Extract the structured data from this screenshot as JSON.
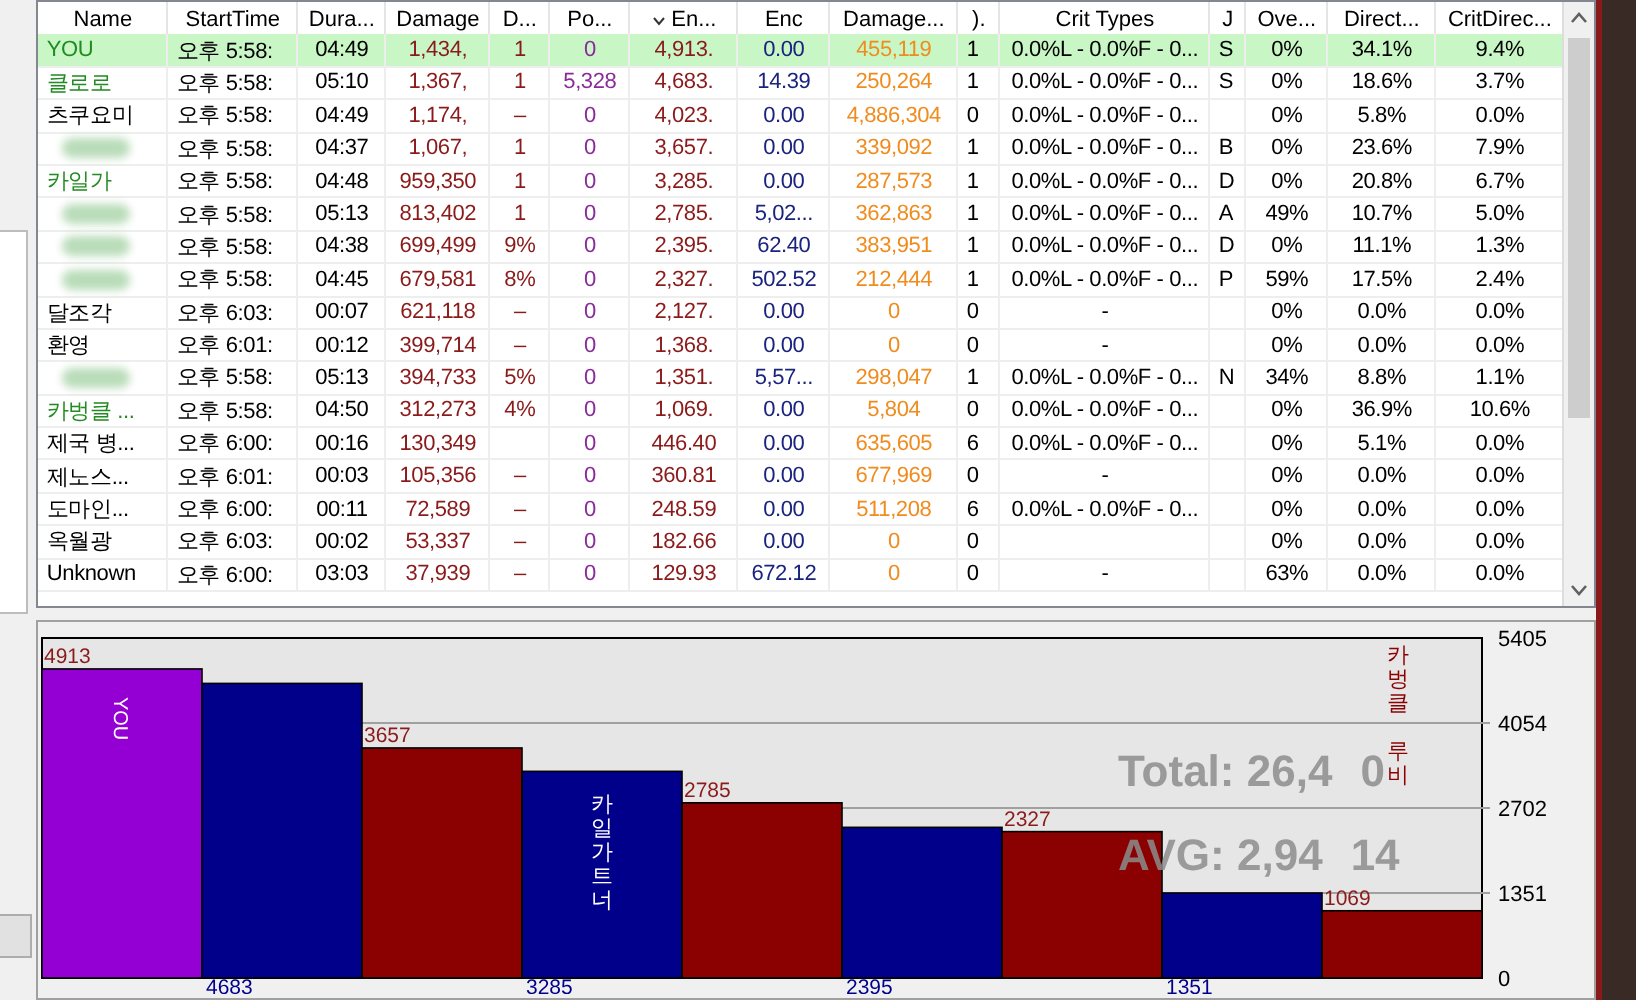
{
  "table": {
    "columns": [
      {
        "label": "Name"
      },
      {
        "label": "StartTime"
      },
      {
        "label": "Dura..."
      },
      {
        "label": "Damage"
      },
      {
        "label": "D..."
      },
      {
        "label": "Po..."
      },
      {
        "label": "En...",
        "sorted": true
      },
      {
        "label": "Enc"
      },
      {
        "label": "Damage..."
      },
      {
        "label": ")."
      },
      {
        "label": "Crit Types"
      },
      {
        "label": "J"
      },
      {
        "label": "Ove..."
      },
      {
        "label": "Direct..."
      },
      {
        "label": "CritDirec..."
      }
    ],
    "rows": [
      {
        "selected": true,
        "color": "#228b22",
        "cells": [
          "YOU",
          "오후 5:58:",
          "04:49",
          "1,434,",
          "1",
          "0",
          "4,913.",
          "0.00",
          "455,119",
          "1",
          "0.0%L - 0.0%F - 0...",
          "S",
          "0%",
          "34.1%",
          "9.4%"
        ]
      },
      {
        "selected": false,
        "color": "#228b22",
        "cells": [
          "클로로",
          "오후 5:58:",
          "05:10",
          "1,367,",
          "1",
          "5,328",
          "4,683.",
          "14.39",
          "250,264",
          "1",
          "0.0%L - 0.0%F - 0...",
          "S",
          "0%",
          "18.6%",
          "3.7%"
        ]
      },
      {
        "selected": false,
        "color": "#000000",
        "cells": [
          "츠쿠요미",
          "오후 5:58:",
          "04:49",
          "1,174,",
          "–",
          "0",
          "4,023.",
          "0.00",
          "4,886,304",
          "0",
          "0.0%L - 0.0%F - 0...",
          null,
          "0%",
          "5.8%",
          "0.0%"
        ]
      },
      {
        "selected": false,
        "cells": [
          null,
          "오후 5:58:",
          "04:37",
          "1,067,",
          "1",
          "0",
          "3,657.",
          "0.00",
          "339,092",
          "1",
          "0.0%L - 0.0%F - 0...",
          "B",
          "0%",
          "23.6%",
          "7.9%"
        ]
      },
      {
        "selected": false,
        "color": "#228b22",
        "cells": [
          "카일가",
          "오후 5:58:",
          "04:48",
          "959,350",
          "1",
          "0",
          "3,285.",
          "0.00",
          "287,573",
          "1",
          "0.0%L - 0.0%F - 0...",
          "D",
          "0%",
          "20.8%",
          "6.7%"
        ]
      },
      {
        "selected": false,
        "cells": [
          null,
          "오후 5:58:",
          "05:13",
          "813,402",
          "1",
          "0",
          "2,785.",
          "5,02...",
          "362,863",
          "1",
          "0.0%L - 0.0%F - 0...",
          "A",
          "49%",
          "10.7%",
          "5.0%"
        ]
      },
      {
        "selected": false,
        "cells": [
          null,
          "오후 5:58:",
          "04:38",
          "699,499",
          "9%",
          "0",
          "2,395.",
          "62.40",
          "383,951",
          "1",
          "0.0%L - 0.0%F - 0...",
          "D",
          "0%",
          "11.1%",
          "1.3%"
        ]
      },
      {
        "selected": false,
        "cells": [
          null,
          "오후 5:58:",
          "04:45",
          "679,581",
          "8%",
          "0",
          "2,327.",
          "502.52",
          "212,444",
          "1",
          "0.0%L - 0.0%F - 0...",
          "P",
          "59%",
          "17.5%",
          "2.4%"
        ]
      },
      {
        "selected": false,
        "color": "#000000",
        "cells": [
          "달조각",
          "오후 6:03:",
          "00:07",
          "621,118",
          "–",
          "0",
          "2,127.",
          "0.00",
          "0",
          "0",
          "-",
          null,
          "0%",
          "0.0%",
          "0.0%"
        ]
      },
      {
        "selected": false,
        "color": "#000000",
        "cells": [
          "환영",
          "오후 6:01:",
          "00:12",
          "399,714",
          "–",
          "0",
          "1,368.",
          "0.00",
          "0",
          "0",
          "-",
          null,
          "0%",
          "0.0%",
          "0.0%"
        ]
      },
      {
        "selected": false,
        "cells": [
          null,
          "오후 5:58:",
          "05:13",
          "394,733",
          "5%",
          "0",
          "1,351.",
          "5,57...",
          "298,047",
          "1",
          "0.0%L - 0.0%F - 0...",
          "N",
          "34%",
          "8.8%",
          "1.1%"
        ]
      },
      {
        "selected": false,
        "color": "#228b22",
        "cells": [
          "카벙클 ...",
          "오후 5:58:",
          "04:50",
          "312,273",
          "4%",
          "0",
          "1,069.",
          "0.00",
          "5,804",
          "0",
          "0.0%L - 0.0%F - 0...",
          null,
          "0%",
          "36.9%",
          "10.6%"
        ]
      },
      {
        "selected": false,
        "color": "#000000",
        "cells": [
          "제국 병...",
          "오후 6:00:",
          "00:16",
          "130,349",
          null,
          "0",
          "446.40",
          "0.00",
          "635,605",
          "6",
          "0.0%L - 0.0%F - 0...",
          null,
          "0%",
          "5.1%",
          "0.0%"
        ]
      },
      {
        "selected": false,
        "color": "#000000",
        "cells": [
          "제노스...",
          "오후 6:01:",
          "00:03",
          "105,356",
          "–",
          "0",
          "360.81",
          "0.00",
          "677,969",
          "0",
          "-",
          null,
          "0%",
          "0.0%",
          "0.0%"
        ]
      },
      {
        "selected": false,
        "color": "#000000",
        "cells": [
          "도마인...",
          "오후 6:00:",
          "00:11",
          "72,589",
          "–",
          "0",
          "248.59",
          "0.00",
          "511,208",
          "6",
          "0.0%L - 0.0%F - 0...",
          null,
          "0%",
          "0.0%",
          "0.0%"
        ]
      },
      {
        "selected": false,
        "color": "#000000",
        "cells": [
          "옥월광",
          "오후 6:03:",
          "00:02",
          "53,337",
          "–",
          "0",
          "182.66",
          "0.00",
          "0",
          "0",
          null,
          null,
          "0%",
          "0.0%",
          "0.0%"
        ]
      },
      {
        "selected": false,
        "color": "#000000",
        "cells": [
          "Unknown",
          "오후 6:00:",
          "03:03",
          "37,939",
          "–",
          "0",
          "129.93",
          "672.12",
          "0",
          "0",
          "-",
          null,
          "63%",
          "0.0%",
          "0.0%"
        ]
      }
    ]
  },
  "graph": {
    "total": [
      "Total: 26,4",
      "0"
    ],
    "average": [
      "AVG: 2,94",
      "14"
    ],
    "chart_data": {
      "type": "bar",
      "categories": [
        "YOU",
        null,
        null,
        "카일가트너",
        null,
        null,
        null,
        null,
        "카벙클 루비"
      ],
      "values": [
        4913,
        4683,
        3657,
        3285,
        2785,
        2395,
        2327,
        1351,
        1069
      ],
      "ylim": [
        0,
        5405
      ],
      "yticks": [
        0,
        1351,
        2702,
        4054,
        5405
      ],
      "data_labels": true,
      "grid": true
    }
  }
}
